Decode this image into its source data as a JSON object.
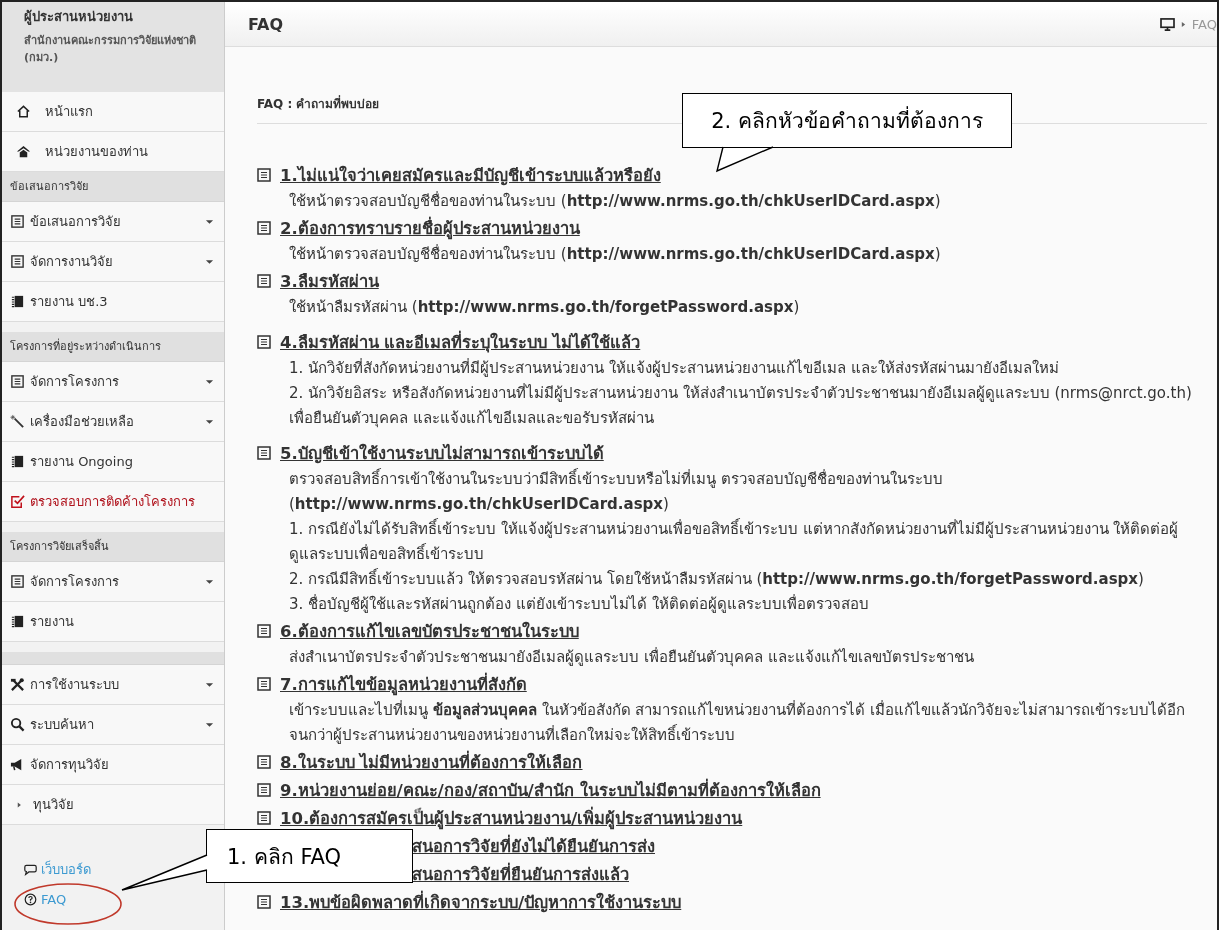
{
  "sidebar": {
    "title": "ผู้ประสานหน่วยงาน",
    "subtitle": "สำนักงานคณะกรรมการวิจัยแห่งชาติ (กมว.)",
    "groups": [
      {
        "kind": "plain",
        "items": [
          {
            "label": "หน้าแรก",
            "dropdown": false,
            "alert": false
          },
          {
            "label": "หน่วยงานของท่าน",
            "dropdown": false,
            "alert": false
          }
        ]
      },
      {
        "kind": "titled",
        "heading": "ข้อเสนอการวิจัย",
        "items": [
          {
            "label": "ข้อเสนอการวิจัย",
            "dropdown": true,
            "alert": false
          },
          {
            "label": "จัดการงานวิจัย",
            "dropdown": true,
            "alert": false
          },
          {
            "label": "รายงาน บช.3",
            "dropdown": false,
            "alert": false
          }
        ]
      },
      {
        "kind": "titled",
        "heading": "โครงการที่อยู่ระหว่างดำเนินการ",
        "items": [
          {
            "label": "จัดการโครงการ",
            "dropdown": true,
            "alert": false
          },
          {
            "label": "เครื่องมือช่วยเหลือ",
            "dropdown": true,
            "alert": false
          },
          {
            "label": "รายงาน Ongoing",
            "dropdown": false,
            "alert": false
          },
          {
            "label": "ตรวจสอบการติดค้างโครงการ",
            "dropdown": false,
            "alert": true
          }
        ]
      },
      {
        "kind": "titled",
        "heading": "โครงการวิจัยเสร็จสิ้น",
        "items": [
          {
            "label": "จัดการโครงการ",
            "dropdown": true,
            "alert": false
          },
          {
            "label": "รายงาน",
            "dropdown": false,
            "alert": false
          }
        ]
      },
      {
        "kind": "untitled",
        "items": [
          {
            "label": "การใช้งานระบบ",
            "dropdown": true,
            "alert": false
          },
          {
            "label": "ระบบค้นหา",
            "dropdown": true,
            "alert": false
          },
          {
            "label": "จัดการทุนวิจัย",
            "dropdown": false,
            "alert": false
          },
          {
            "label": "ทุนวิจัย",
            "dropdown": false,
            "alert": false
          }
        ]
      }
    ],
    "footer_links": [
      "เว็บบอร์ด",
      "FAQ"
    ]
  },
  "header": {
    "title": "FAQ",
    "breadcrumb": "FAQ"
  },
  "subheader": "FAQ : คำถามที่พบบ่อย",
  "faq": [
    {
      "kind": "full",
      "title": "1.ไม่แน่ใจว่าเคยสมัครและมีบัญชีเข้าระบบแล้วหรือยัง",
      "body": [
        "ใช้หน้าตรวจสอบบัญชีชื่อของท่านในระบบ (**http://www.nrms.go.th/chkUserIDCard.aspx**)"
      ]
    },
    {
      "kind": "full",
      "title": "2.ต้องการทราบรายชื่อผู้ประสานหน่วยงาน",
      "body": [
        "ใช้หน้าตรวจสอบบัญชีชื่อของท่านในระบบ (**http://www.nrms.go.th/chkUserIDCard.aspx**)"
      ]
    },
    {
      "kind": "full",
      "title": "3.ลืมรหัสผ่าน",
      "body": [
        "ใช้หน้าลืมรหัสผ่าน (**http://www.nrms.go.th/forgetPassword.aspx**)"
      ]
    },
    {
      "kind": "full",
      "title": "4.ลืมรหัสผ่าน และอีเมลที่ระบุในระบบ ไม่ได้ใช้แล้ว",
      "body": [
        "1. นักวิจัยที่สังกัดหน่วยงานที่มีผู้ประสานหน่วยงาน ให้แจ้งผู้ประสานหน่วยงานแก้ไขอีเมล และให้ส่งรหัสผ่านมายังอีเมลใหม่",
        "2. นักวิจัยอิสระ หรือสังกัดหน่วยงานที่ไม่มีผู้ประสานหน่วยงาน ให้ส่งสำเนาบัตรประจำตัวประชาชนมายังอีเมลผู้ดูแลระบบ (nrms@nrct.go.th) เพื่อยืนยันตัวบุคคล และแจ้งแก้ไขอีเมลและขอรับรหัสผ่าน"
      ]
    },
    {
      "kind": "full",
      "title": "5.บัญชีเข้าใช้งานระบบไม่สามารถเข้าระบบได้",
      "body": [
        "ตรวจสอบสิทธิ์การเข้าใช้งานในระบบว่ามีสิทธิ์เข้าระบบหรือไม่ที่เมนู ตรวจสอบบัญชีชื่อของท่านในระบบ (**http://www.nrms.go.th/chkUserIDCard.aspx**)",
        "1. กรณียังไม่ได้รับสิทธิ์เข้าระบบ ให้แจ้งผู้ประสานหน่วยงานเพื่อขอสิทธิ์เข้าระบบ แต่หากสังกัดหน่วยงานที่ไม่มีผู้ประสานหน่วยงาน ให้ติดต่อผู้ดูแลระบบเพื่อขอสิทธิ์เข้าระบบ",
        "2. กรณีมีสิทธิ์เข้าระบบแล้ว ให้ตรวจสอบรหัสผ่าน โดยใช้หน้าลืมรหัสผ่าน (**http://www.nrms.go.th/forgetPassword.aspx**)",
        "3. ชื่อบัญชีผู้ใช้และรหัสผ่านถูกต้อง แต่ยังเข้าระบบไม่ได้ ให้ติดต่อผู้ดูแลระบบเพื่อตรวจสอบ"
      ]
    },
    {
      "kind": "full",
      "title": "6.ต้องการแก้ไขเลขบัตรประชาชนในระบบ",
      "body": [
        "ส่งสำเนาบัตรประจำตัวประชาชนมายังอีเมลผู้ดูแลระบบ เพื่อยืนยันตัวบุคคล และแจ้งแก้ไขเลขบัตรประชาชน"
      ]
    },
    {
      "kind": "full",
      "title": "7.การแก้ไขข้อมูลหน่วยงานที่สังกัด",
      "body": [
        "เข้าระบบและไปที่เมนู **ข้อมูลส่วนบุคคล** ในหัวข้อสังกัด สามารถแก้ไขหน่วยงานที่ต้องการได้ เมื่อแก้ไขแล้วนักวิจัยจะไม่สามารถเข้าระบบได้อีก จนกว่าผู้ประสานหน่วยงานของหน่วยงานที่เลือกใหม่จะให้สิทธิ์เข้าระบบ"
      ]
    },
    {
      "kind": "full",
      "title": "8.ในระบบ ไม่มีหน่วยงานที่ต้องการให้เลือก"
    },
    {
      "kind": "full",
      "title": "9.หน่วยงานย่อย/คณะ/กอง/สถาบัน/สำนัก ในระบบไม่มีตามที่ต้องการให้เลือก"
    },
    {
      "kind": "full",
      "title": "10.ต้องการสมัครเป็นผู้ประสานหน่วยงาน/เพิ่มผู้ประสานหน่วยงาน"
    },
    {
      "kind": "covered",
      "title": "สนอการวิจัยที่ยังไม่ได้ยืนยันการส่ง"
    },
    {
      "kind": "covered",
      "title": "สนอการวิจัยที่ยืนยันการส่งแล้ว"
    },
    {
      "kind": "full",
      "title": "13.พบข้อผิดพลาดที่เกิดจากระบบ/ปัญหาการใช้งานระบบ"
    }
  ],
  "callouts": [
    "1. คลิก FAQ",
    "2. คลิกหัวข้อคำถามที่ต้องการ"
  ]
}
